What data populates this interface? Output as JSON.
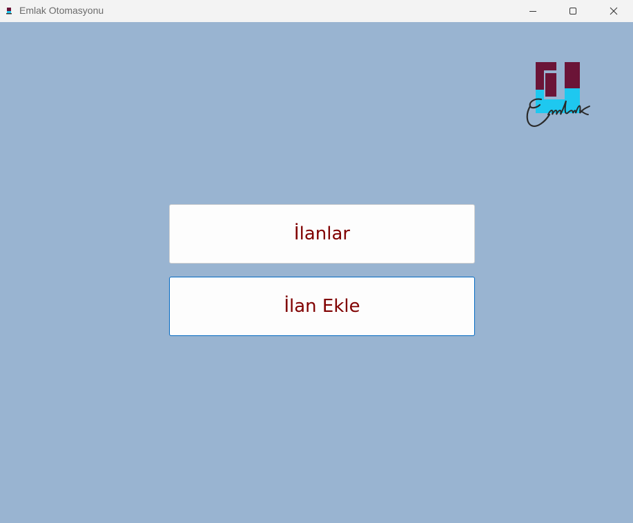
{
  "window": {
    "title": "Emlak Otomasyonu"
  },
  "colors": {
    "background": "#99b4d1",
    "button_text": "#800000",
    "logo_maroon": "#6b1437",
    "logo_cyan": "#1ec8f0"
  },
  "logo": {
    "text": "Emlak"
  },
  "menu": {
    "listings_label": "İlanlar",
    "add_listing_label": "İlan Ekle"
  }
}
